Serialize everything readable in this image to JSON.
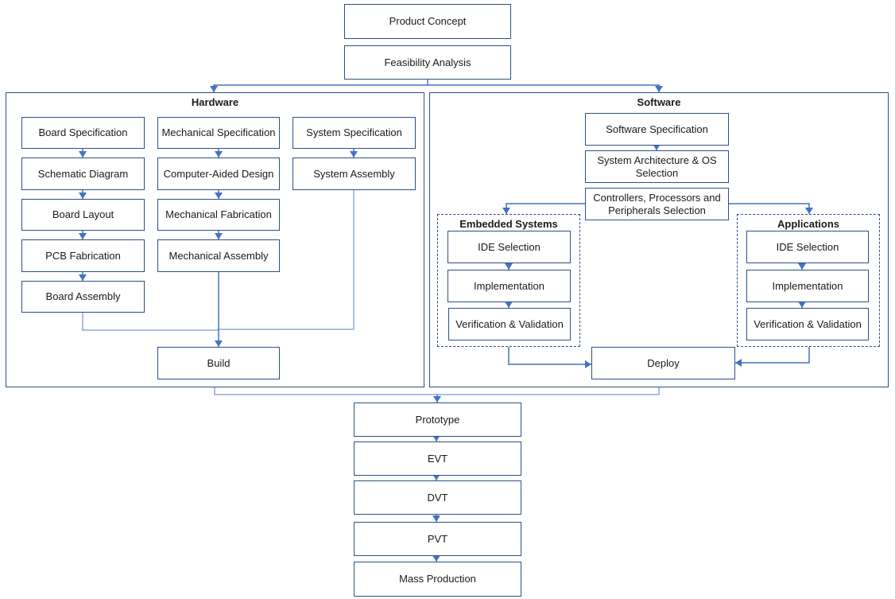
{
  "top": {
    "product_concept": "Product Concept",
    "feasibility_analysis": "Feasibility Analysis"
  },
  "hardware": {
    "title": "Hardware",
    "board_column": [
      "Board Specification",
      "Schematic Diagram",
      "Board Layout",
      "PCB Fabrication",
      "Board Assembly"
    ],
    "mechanical_column": [
      "Mechanical Specification",
      "Computer-Aided Design",
      "Mechanical Fabrication",
      "Mechanical Assembly"
    ],
    "system_column": [
      "System Specification",
      "System Assembly"
    ],
    "build": "Build"
  },
  "software": {
    "title": "Software",
    "software_specification": "Software Specification",
    "system_architecture": "System Architecture & OS Selection",
    "controllers_selection": "Controllers, Processors and Peripherals Selection",
    "embedded": {
      "title": "Embedded Systems",
      "steps": [
        "IDE Selection",
        "Implementation",
        "Verification & Validation"
      ]
    },
    "applications": {
      "title": "Applications",
      "steps": [
        "IDE Selection",
        "Implementation",
        "Verification & Validation"
      ]
    },
    "deploy": "Deploy"
  },
  "bottom": [
    "Prototype",
    "EVT",
    "DVT",
    "PVT",
    "Mass Production"
  ],
  "colors": {
    "border": "#2f4f86",
    "arrow": "#4472c4",
    "wire_light": "#8eaadb"
  }
}
